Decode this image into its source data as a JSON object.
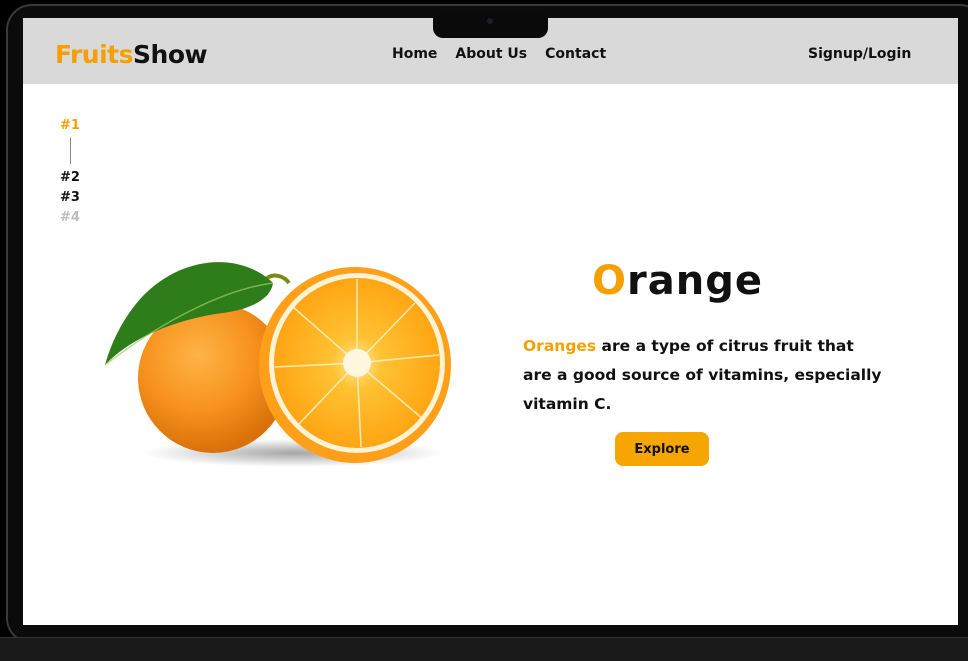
{
  "brand": {
    "part1": "Fruits",
    "part2": "Show"
  },
  "nav": {
    "home": "Home",
    "about": "About Us",
    "contact": "Contact",
    "signup": "Signup/Login"
  },
  "slides": [
    "#1",
    "#2",
    "#3",
    "#4"
  ],
  "hero": {
    "title_first": "O",
    "title_rest": "range",
    "highlight": "Oranges",
    "description": " are a type of citrus fruit that are a good source of vitamins, especially vitamin C.",
    "button": "Explore"
  },
  "colors": {
    "accent": "#f5a000",
    "navbar": "#d9d9d9"
  }
}
